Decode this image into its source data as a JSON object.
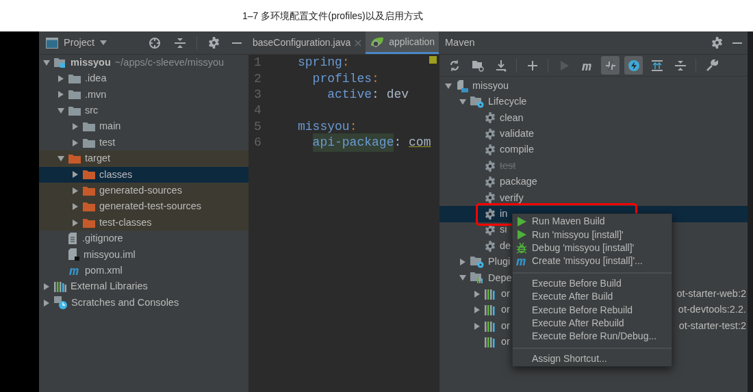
{
  "page_title": "1–7 多环境配置文件(profiles)以及启用方式",
  "project_panel": {
    "title": "Project",
    "tree": [
      {
        "label": "missyou",
        "path": "~/apps/c-sleeve/missyou",
        "kind": "module",
        "expanded": true,
        "children": [
          {
            "label": ".idea",
            "kind": "folder",
            "expanded": false
          },
          {
            "label": ".mvn",
            "kind": "folder",
            "expanded": false
          },
          {
            "label": "src",
            "kind": "folder",
            "expanded": true,
            "children": [
              {
                "label": "main",
                "kind": "folder",
                "expanded": false
              },
              {
                "label": "test",
                "kind": "folder",
                "expanded": false
              }
            ]
          },
          {
            "label": "target",
            "kind": "excluded",
            "expanded": true,
            "children": [
              {
                "label": "classes",
                "kind": "excluded",
                "expanded": false,
                "selected": true
              },
              {
                "label": "generated-sources",
                "kind": "excluded",
                "expanded": false,
                "selected": false
              },
              {
                "label": "generated-test-sources",
                "kind": "excluded",
                "expanded": false,
                "selected": false
              },
              {
                "label": "test-classes",
                "kind": "excluded",
                "expanded": false,
                "selected": false
              }
            ]
          },
          {
            "label": ".gitignore",
            "kind": "file"
          },
          {
            "label": "missyou.iml",
            "kind": "iml"
          },
          {
            "label": "pom.xml",
            "kind": "maven"
          }
        ]
      },
      {
        "label": "External Libraries",
        "kind": "libraries",
        "expanded": false
      },
      {
        "label": "Scratches and Consoles",
        "kind": "scratches",
        "expanded": false
      }
    ]
  },
  "editor": {
    "tabs": [
      {
        "label": "baseConfiguration.java",
        "selected": false,
        "closable": true
      },
      {
        "label": "application",
        "selected": true,
        "closable": false
      }
    ],
    "lines": [
      {
        "number": "1",
        "tokens": [
          {
            "text": "spring",
            "kind": "key"
          },
          {
            "text": ":",
            "kind": "punct"
          }
        ]
      },
      {
        "number": "2",
        "tokens": [
          {
            "text": "  profiles",
            "kind": "key"
          },
          {
            "text": ":",
            "kind": "punct"
          }
        ]
      },
      {
        "number": "3",
        "tokens": [
          {
            "text": "    active",
            "kind": "key"
          },
          {
            "text": ": dev",
            "kind": "value"
          }
        ]
      },
      {
        "number": "4"
      },
      {
        "number": "5",
        "tokens": [
          {
            "text": "missyou",
            "kind": "key"
          },
          {
            "text": ":",
            "kind": "punct"
          }
        ]
      },
      {
        "number": "6",
        "tokens": [
          {
            "text": "  api-package",
            "kind": "marked"
          },
          {
            "text": ": ",
            "kind": "value"
          },
          {
            "text": "com",
            "kind": "underlined"
          }
        ]
      }
    ]
  },
  "maven": {
    "title": "Maven",
    "toolbar": [
      {
        "kind": "refresh",
        "selected": false,
        "disabled": false
      },
      {
        "kind": "folder-refresh",
        "selected": false,
        "disabled": false
      },
      {
        "kind": "download",
        "selected": false,
        "disabled": false
      },
      {
        "kind": "sep"
      },
      {
        "kind": "plus",
        "selected": false,
        "disabled": false
      },
      {
        "kind": "sep"
      },
      {
        "kind": "run",
        "selected": false,
        "disabled": true
      },
      {
        "kind": "maven",
        "selected": false,
        "disabled": false
      },
      {
        "kind": "offline",
        "selected": true,
        "disabled": false
      },
      {
        "kind": "lightning",
        "selected": true,
        "disabled": false
      },
      {
        "kind": "expand",
        "selected": false,
        "disabled": false
      },
      {
        "kind": "collapse",
        "selected": false,
        "disabled": false
      },
      {
        "kind": "sep"
      },
      {
        "kind": "wrench",
        "selected": false,
        "disabled": false
      }
    ],
    "tree": [
      {
        "label": "missyou",
        "kind": "project",
        "expanded": true,
        "children": [
          {
            "label": "Lifecycle",
            "kind": "group",
            "expanded": true,
            "children": [
              {
                "label": "clean",
                "kind": "goal",
                "disabled": false,
                "selected": false
              },
              {
                "label": "validate",
                "kind": "goal",
                "disabled": false,
                "selected": false
              },
              {
                "label": "compile",
                "kind": "goal",
                "disabled": false,
                "selected": false
              },
              {
                "label": "test",
                "kind": "goal",
                "disabled": true,
                "selected": false
              },
              {
                "label": "package",
                "kind": "goal",
                "disabled": false,
                "selected": false
              },
              {
                "label": "verify",
                "kind": "goal",
                "disabled": false,
                "selected": false
              },
              {
                "label": "in",
                "kind": "goal",
                "disabled": false,
                "selected": true
              },
              {
                "label": "si",
                "kind": "goal",
                "disabled": false,
                "selected": false
              },
              {
                "label": "de",
                "kind": "goal",
                "disabled": false,
                "selected": false
              }
            ]
          },
          {
            "label": "Plugi",
            "kind": "group",
            "expanded": false
          },
          {
            "label": "Depe",
            "kind": "deps",
            "expanded": true,
            "children": [
              {
                "label": "or",
                "tail": "ot-starter-web:2",
                "kind": "dep",
                "expanded": false
              },
              {
                "label": "or",
                "tail": "ot-devtools:2.2.",
                "kind": "dep",
                "expanded": false
              },
              {
                "label": "or",
                "tail": "ot-starter-test:2",
                "kind": "dep",
                "expanded": false
              },
              {
                "label": "or",
                "kind": "dep"
              }
            ]
          }
        ]
      }
    ]
  },
  "context_menu": {
    "groups": [
      [
        {
          "label": "Run Maven Build",
          "kind": "run"
        },
        {
          "label": "Run 'missyou [install]'",
          "kind": "run"
        },
        {
          "label": "Debug 'missyou [install]'",
          "kind": "debug"
        },
        {
          "label": "Create 'missyou [install]'...",
          "kind": "maven"
        }
      ],
      [
        {
          "label": "Execute Before Build",
          "kind": "plain"
        },
        {
          "label": "Execute After Build",
          "kind": "plain"
        },
        {
          "label": "Execute Before Rebuild",
          "kind": "plain"
        },
        {
          "label": "Execute After Rebuild",
          "kind": "plain"
        },
        {
          "label": "Execute Before Run/Debug...",
          "kind": "plain"
        }
      ],
      [
        {
          "label": "Assign Shortcut...",
          "kind": "plain"
        }
      ]
    ]
  }
}
